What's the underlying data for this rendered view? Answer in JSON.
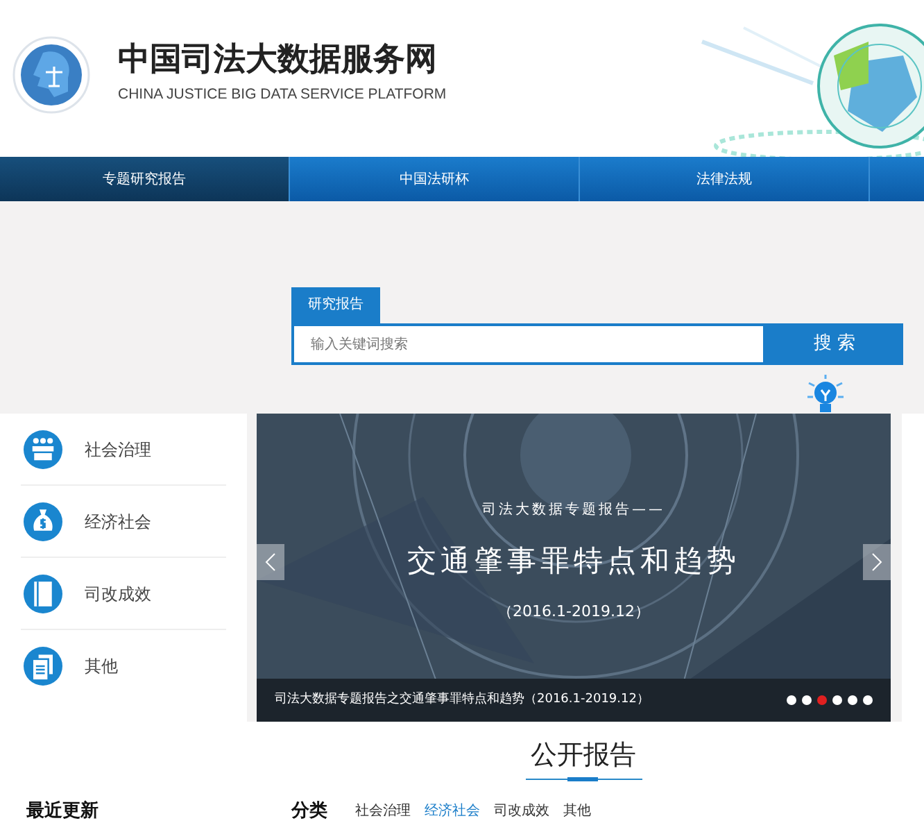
{
  "header": {
    "title": "中国司法大数据服务网",
    "subtitle": "CHINA JUSTICE BIG DATA SERVICE PLATFORM"
  },
  "nav": [
    {
      "label": "专题研究报告",
      "selected": true
    },
    {
      "label": "中国法研杯",
      "selected": false
    },
    {
      "label": "法律法规",
      "selected": false
    }
  ],
  "search": {
    "tab": "研究报告",
    "placeholder": "输入关键词搜索",
    "button": "搜 索"
  },
  "categories": [
    {
      "kind": "people",
      "label": "社会治理"
    },
    {
      "kind": "money",
      "label": "经济社会"
    },
    {
      "kind": "book",
      "label": "司改成效"
    },
    {
      "kind": "docs",
      "label": "其他"
    }
  ],
  "slide": {
    "kicker": "司法大数据专题报告——",
    "headline": "交通肇事罪特点和趋势",
    "period": "（2016.1-2019.12）",
    "caption": "司法大数据专题报告之交通肇事罪特点和趋势（2016.1-2019.12）",
    "dots": [
      {
        "selected": false
      },
      {
        "selected": false
      },
      {
        "selected": true
      },
      {
        "selected": false
      },
      {
        "selected": false
      },
      {
        "selected": false
      }
    ]
  },
  "section": {
    "title": "公开报告"
  },
  "latest": {
    "title": "最近更新"
  },
  "filter": {
    "title": "分类",
    "options": [
      {
        "label": "社会治理",
        "selected": false
      },
      {
        "label": "经济社会",
        "selected": true
      },
      {
        "label": "司改成效",
        "selected": false
      },
      {
        "label": "其他",
        "selected": false
      }
    ]
  }
}
